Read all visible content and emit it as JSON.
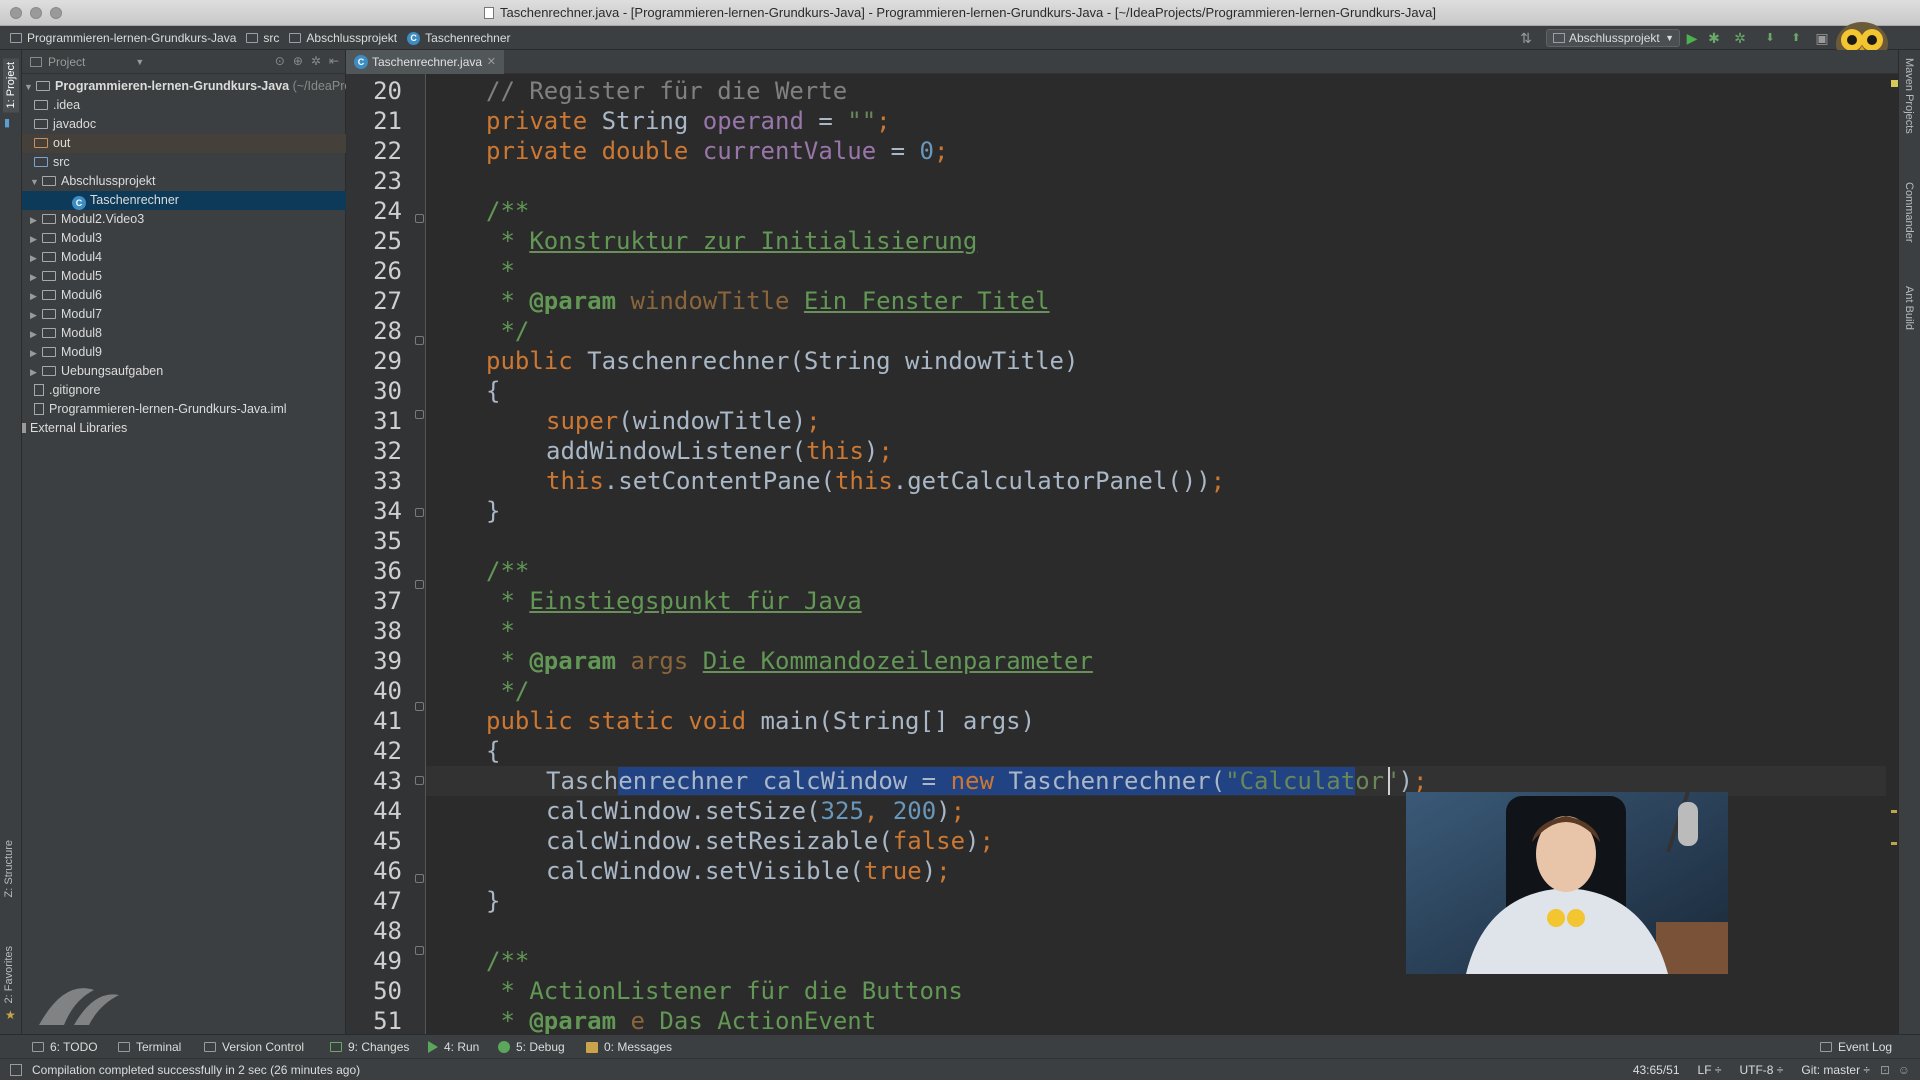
{
  "window": {
    "title": "Taschenrechner.java - [Programmieren-lernen-Grundkurs-Java] - Programmieren-lernen-Grundkurs-Java - [~/IdeaProjects/Programmieren-lernen-Grundkurs-Java]"
  },
  "navbar": {
    "crumbs": [
      "Programmieren-lernen-Grundkurs-Java",
      "src",
      "Abschlussprojekt",
      "Taschenrechner"
    ],
    "run_config": "Abschlussprojekt"
  },
  "left_strip": {
    "project_tab": "1: Project",
    "structure_tab": "Z: Structure",
    "favorites_tab": "2: Favorites"
  },
  "right_strip": {
    "maven_tab": "Maven Projects",
    "commander_tab": "Commander",
    "ant_tab": "Ant Build"
  },
  "project_panel": {
    "header": "Project",
    "tree": [
      {
        "label": "Programmieren-lernen-Grundkurs-Java",
        "path": "(~/IdeaPro",
        "type": "root",
        "expanded": true
      },
      {
        "label": ".idea",
        "type": "folder"
      },
      {
        "label": "javadoc",
        "type": "folder"
      },
      {
        "label": "out",
        "type": "folder-out"
      },
      {
        "label": "src",
        "type": "folder-src",
        "expanded": true
      },
      {
        "label": "Abschlussprojekt",
        "type": "package",
        "expanded": true
      },
      {
        "label": "Taschenrechner",
        "type": "class",
        "selected": true
      },
      {
        "label": "Modul2.Video3",
        "type": "package"
      },
      {
        "label": "Modul3",
        "type": "package"
      },
      {
        "label": "Modul4",
        "type": "package"
      },
      {
        "label": "Modul5",
        "type": "package"
      },
      {
        "label": "Modul6",
        "type": "package"
      },
      {
        "label": "Modul7",
        "type": "package"
      },
      {
        "label": "Modul8",
        "type": "package"
      },
      {
        "label": "Modul9",
        "type": "package"
      },
      {
        "label": "Uebungsaufgaben",
        "type": "package"
      },
      {
        "label": ".gitignore",
        "type": "file"
      },
      {
        "label": "Programmieren-lernen-Grundkurs-Java.iml",
        "type": "file"
      },
      {
        "label": "External Libraries",
        "type": "libraries"
      }
    ]
  },
  "editor": {
    "tab_label": "Taschenrechner.java",
    "line_numbers": [
      "20",
      "21",
      "22",
      "23",
      "24",
      "25",
      "26",
      "27",
      "28",
      "29",
      "30",
      "31",
      "32",
      "33",
      "34",
      "35",
      "36",
      "37",
      "38",
      "39",
      "40",
      "41",
      "42",
      "43",
      "44",
      "45",
      "46",
      "47",
      "48",
      "49",
      "50",
      "51"
    ],
    "code": {
      "l20": "// Register für die Werte",
      "l21_kw": "private ",
      "l21_type": "String ",
      "l21_field": "operand",
      "l21_eq": " = ",
      "l21_str": "\"\"",
      "l21_semi": ";",
      "l22_kw": "private double ",
      "l22_field": "currentValue",
      "l22_eq": " = ",
      "l22_num": "0",
      "l22_semi": ";",
      "l24": "/**",
      "l25_star": " * ",
      "l25_text": "Konstruktur zur Initialisierung",
      "l26": " *",
      "l27_star": " * ",
      "l27_tag": "@param ",
      "l27_param": "windowTitle ",
      "l27_text": "Ein Fenster Titel",
      "l28": " */",
      "l29_kw": "public ",
      "l29_rest": "Taschenrechner(String windowTitle)",
      "l30": "{",
      "l31_kw": "super",
      "l31_rest": "(windowTitle)",
      "l31_semi": ";",
      "l32_pre": "addWindowListener(",
      "l32_kw": "this",
      "l32_post": ")",
      "l32_semi": ";",
      "l33_kw1": "this",
      "l33_mid": ".setContentPane(",
      "l33_kw2": "this",
      "l33_post": ".getCalculatorPanel())",
      "l33_semi": ";",
      "l34": "}",
      "l36": "/**",
      "l37_star": " * ",
      "l37_text": "Einstiegspunkt für Java",
      "l38": " *",
      "l39_star": " * ",
      "l39_tag": "@param ",
      "l39_param": "args ",
      "l39_text": "Die Kommandozeilenparameter",
      "l40": " */",
      "l41_kw": "public static void ",
      "l41_rest": "main(String[] args)",
      "l42": "{",
      "l43_pre": "Tasch",
      "l43_sel1": "enrechner calcWindow = ",
      "l43_selkw": "new ",
      "l43_sel2": "Taschenrechner(",
      "l43_selstr": "\"Calculat",
      "l43_str": "or\"",
      "l43_post": ")",
      "l43_semi": ";",
      "l44_pre": "calcWindow.setSize(",
      "l44_n1": "325",
      "l44_comma": ", ",
      "l44_n2": "200",
      "l44_post": ")",
      "l44_semi": ";",
      "l45_pre": "calcWindow.setResizable(",
      "l45_kw": "false",
      "l45_post": ")",
      "l45_semi": ";",
      "l46_pre": "calcWindow.setVisible(",
      "l46_kw": "true",
      "l46_post": ")",
      "l46_semi": ";",
      "l47": "}",
      "l49": "/**",
      "l50_star": " * ",
      "l50_text": "ActionListener für die Buttons",
      "l51_star": " * ",
      "l51_tag": "@param ",
      "l51_param": "e ",
      "l51_text": "Das ActionEvent"
    }
  },
  "toolbar": {
    "todo": "6: TODO",
    "terminal": "Terminal",
    "vcs": "Version Control",
    "changes": "9: Changes",
    "run": "4: Run",
    "debug": "5: Debug",
    "messages": "0: Messages",
    "event_log": "Event Log"
  },
  "status": {
    "message": "Compilation completed successfully in 2 sec (26 minutes ago)",
    "position": "43:65/51",
    "line_sep": "LF ÷",
    "encoding": "UTF-8 ÷",
    "git": "Git: master ÷"
  },
  "colors": {
    "keyword": "#cc7832",
    "string": "#6a8759",
    "number": "#6897bb",
    "field": "#9876aa",
    "comment": "#808080",
    "javadoc": "#629755",
    "selection": "#214283",
    "tree_selection": "#0d3a58"
  }
}
